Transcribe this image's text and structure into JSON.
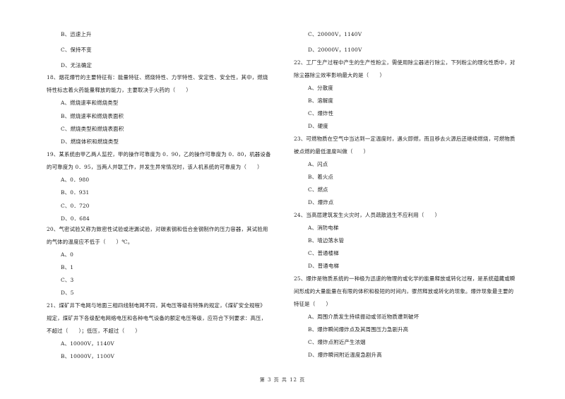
{
  "page": {
    "footer": "第 3 页 共 12 页"
  },
  "left_column": {
    "q17_options": [
      "B、迅速上升",
      "C、保持不变",
      "D、无法确定"
    ],
    "q18": {
      "stem_line1": "18、烟花爆竹的主要特征有：能量特征、燃烧特性、力学特性、安定性、安全性，其中，燃烧",
      "stem_line2": "特性标志着火药能量释放的能力，主要取决于火药的（　　）",
      "options": [
        "A、燃烧速率和燃烧类型",
        "B、燃烧速率和燃烧表面积",
        "C、燃烧类型和燃烧表面积",
        "D、燃烧体积和燃烧类型"
      ]
    },
    "q19": {
      "stem_line1": "19、某系统由甲乙两人监控，甲的操作可靠度为 0．90，乙的操作可靠度为 0．80，机器设备",
      "stem_line2": "的可靠度为 0．95，当两人并联工作，并发生异常情况时，该人机系统的可靠度为（　　）",
      "options": [
        "A、0．980",
        "B、0．931",
        "C、0．720",
        "D、0．684"
      ]
    },
    "q20": {
      "stem_line1": "20、气密试验又称为致密性试验或泄漏试验，对碳素钢和低合金钢制作的压力容器，其试验用",
      "stem_line2": "的气体的温度应不低于（　　）℃。",
      "options": [
        "A、0",
        "B、1",
        "C、3",
        "D、5"
      ]
    },
    "q21": {
      "stem_line1": "21、煤矿井下电网与地面三相四线制电网不同，其电压等级有特殊的规定，《煤矿安全规程》",
      "stem_line2": "规定，煤矿井下各级配电网络电压和各种电气设备的额定电压等级，应符合下列要求：高压，",
      "stem_line3": "不超过（　　）；低压，不超过（　　）",
      "options": [
        "A、10000V，1140V",
        "B、10000V，1100V"
      ]
    }
  },
  "right_column": {
    "q21_options": [
      "C、20000V，1140V",
      "D、20000V，1100V"
    ],
    "q22": {
      "stem_line1": "22、工厂生产过程中产生的生产性粉尘，需使用除尘器进行除尘，下列粉尘的理化性质中，对",
      "stem_line2": "除尘器除尘效率影响最大的是（　　）",
      "options": [
        "A、分散度",
        "B、溶解度",
        "C、爆炸性",
        "D、硬度"
      ]
    },
    "q23": {
      "stem_line1": "23、可燃物质在空气中当达到一定温度时，遇火即燃，而且移去火源后还继续燃烧，可燃物质",
      "stem_line2": "被点燃的最低温度叫做（　　）",
      "options": [
        "A、闪点",
        "B、着火点",
        "C、燃点",
        "D、爆炸点"
      ]
    },
    "q24": {
      "stem_line1": "24、当高层建筑发生火灾时，人员疏散逃生不应利用（　　）",
      "options": [
        "A、消防电梯",
        "B、墙边落水管",
        "C、普通楼梯",
        "D、普通电梯"
      ]
    },
    "q25": {
      "stem_line1": "25、爆炸是物质系统的一种极为迅速的物理的或化学的能量释放或转化过程，是系统蕴藏或瞬",
      "stem_line2": "间形成的大量能量在有限的体积和极短的时间内，骤然释放或转化的现象。爆炸现象最主要的",
      "stem_line3": "特征是（　　）",
      "options": [
        "A、周围介质发生持续振动或邻近物质遭到破坏",
        "B、爆炸瞬间爆炸点及其周围压力急剧升高",
        "C、爆炸点附近产生浓烟",
        "D、爆炸瞬间附近温度急剧升高"
      ]
    }
  }
}
